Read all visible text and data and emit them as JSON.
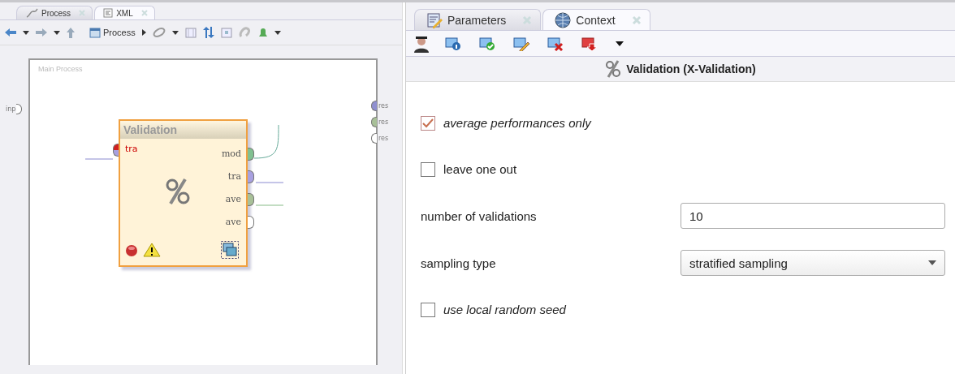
{
  "left_tabs": [
    {
      "label": "Process",
      "selected": true
    },
    {
      "label": "XML",
      "selected": false
    }
  ],
  "left_toolbar": {
    "breadcrumb": "Process"
  },
  "canvas": {
    "title": "Main Process",
    "input_port": {
      "label": "inp"
    },
    "result_ports": [
      {
        "label": "res",
        "color": "#8f8fd0"
      },
      {
        "label": "res",
        "color": "#a8c098"
      },
      {
        "label": "res",
        "color": "#ffffff"
      }
    ],
    "operator": {
      "name": "Validation",
      "input": {
        "label": "tra",
        "color": "#d02020"
      },
      "outputs": [
        {
          "label": "mod",
          "color": "#80c090"
        },
        {
          "label": "tra",
          "color": "#a8a0e0"
        },
        {
          "label": "ave",
          "color": "#a8c098"
        },
        {
          "label": "ave",
          "color": "#ffffff"
        }
      ]
    }
  },
  "right_tabs": [
    {
      "label": "Parameters",
      "selected": true
    },
    {
      "label": "Context",
      "selected": false
    }
  ],
  "operator_title": "Validation (X-Validation)",
  "parameters": [
    {
      "kind": "checkbox",
      "label": "average performances only",
      "checked": true,
      "expert": true
    },
    {
      "kind": "checkbox",
      "label": "leave one out",
      "checked": false,
      "expert": false
    },
    {
      "kind": "text",
      "label": "number of validations",
      "value": "10"
    },
    {
      "kind": "select",
      "label": "sampling type",
      "value": "stratified sampling"
    },
    {
      "kind": "checkbox",
      "label": "use local random seed",
      "checked": false,
      "expert": true
    }
  ]
}
